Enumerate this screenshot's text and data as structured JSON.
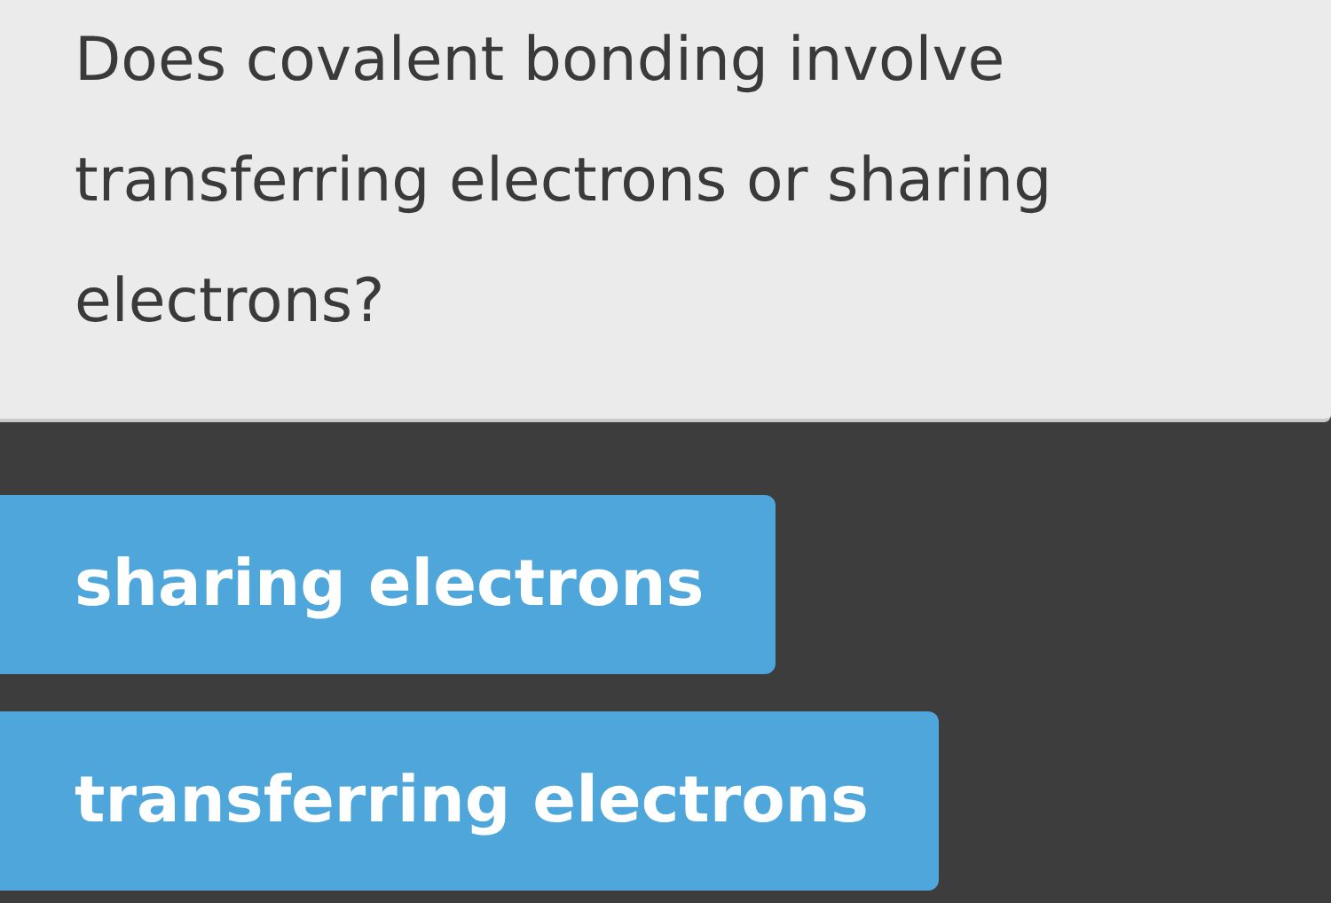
{
  "question": {
    "text": "Does covalent bonding involve transferring electrons or sharing electrons?"
  },
  "answers": [
    {
      "label": "sharing electrons"
    },
    {
      "label": "transferring electrons"
    }
  ]
}
